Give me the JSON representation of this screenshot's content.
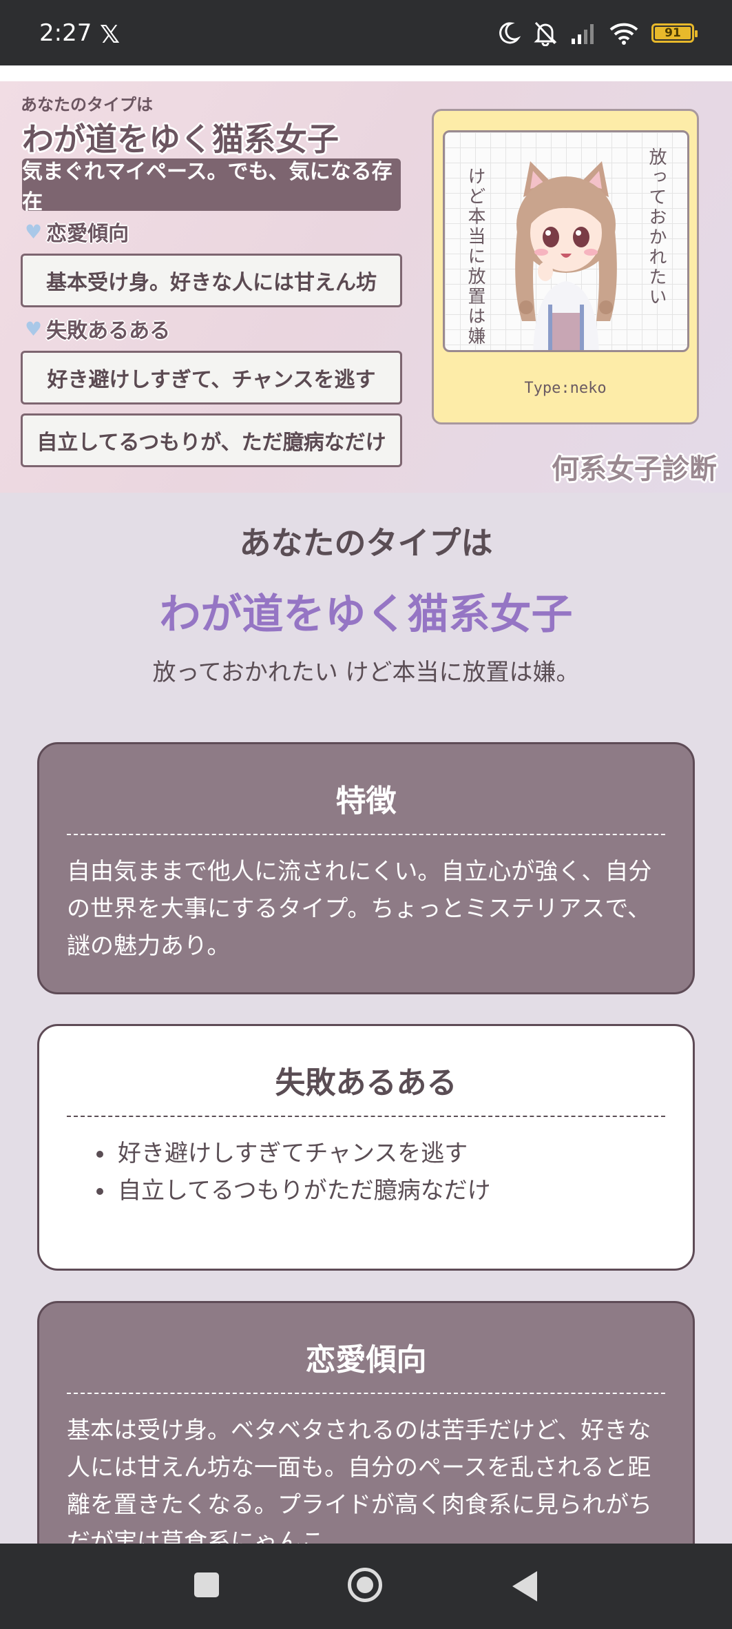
{
  "status_bar": {
    "time": "2:27",
    "battery": "91"
  },
  "banner": {
    "lead": "あなたのタイプは",
    "title": "わが道をゆく猫系女子",
    "tagline": "気まぐれマイペース。でも、気になる存在",
    "love_heading": "恋愛傾向",
    "love_box": "基本受け身。好きな人には甘えん坊",
    "fail_heading": "失敗あるある",
    "fail_box_1": "好き避けしすぎて、チャンスを逃す",
    "fail_box_2": "自立してるつもりが、ただ臆病なだけ",
    "card_text_1": "放っておかれたい",
    "card_text_2": "けど本当に放置は嫌",
    "card_type": "Type:neko",
    "logo": "何系女子診断"
  },
  "result": {
    "label": "あなたのタイプは",
    "type": "わが道をゆく猫系女子",
    "subtitle": "放っておかれたい けど本当に放置は嫌。"
  },
  "sections": {
    "features": {
      "title": "特徴",
      "body": "自由気ままで他人に流されにくい。自立心が強く、自分の世界を大事にするタイプ。ちょっとミステリアスで、謎の魅力あり。"
    },
    "fails": {
      "title": "失敗あるある",
      "items": [
        "好き避けしすぎてチャンスを逃す",
        "自立してるつもりがただ臆病なだけ"
      ]
    },
    "love": {
      "title": "恋愛傾向",
      "body": "基本は受け身。ベタベタされるのは苦手だけど、好きな人には甘えん坊な一面も。自分のペースを乱されると距離を置きたくなる。プライドが高く肉食系に見られがちだが実は草食系にゃんこ。"
    }
  },
  "colors": {
    "accent_purple": "#9575c4",
    "section_dark": "#8e7b86",
    "page_bg": "#e3dde6",
    "card_yellow": "#fdeca8"
  },
  "icons": [
    "x-logo-icon",
    "moon-icon",
    "bell-off-icon",
    "signal-icon",
    "wifi-icon",
    "battery-icon",
    "heart-icon",
    "cat-girl-illustration",
    "recents-icon",
    "home-icon",
    "back-icon"
  ]
}
